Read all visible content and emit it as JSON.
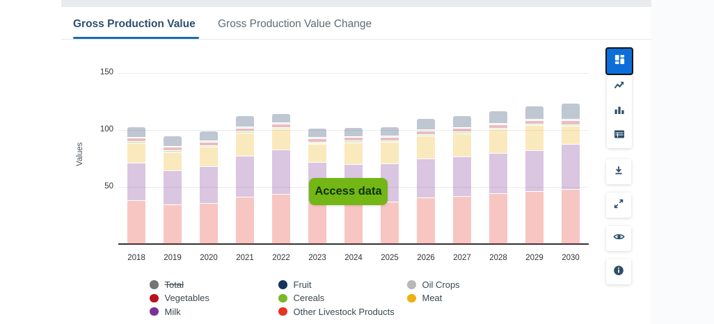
{
  "tabs": [
    {
      "label": "Gross Production Value",
      "active": true
    },
    {
      "label": "Gross Production Value Change",
      "active": false
    }
  ],
  "access_button": {
    "label": "Access data"
  },
  "colors": {
    "accent_blue_underline": "#1b6cb3",
    "active_view_button": "#0b6fd9",
    "access_button_green": "#73b616",
    "axis_line": "#303030",
    "gridline": "#ececec",
    "toolbar_icon": "#2e4d68"
  },
  "chart_data": {
    "type": "bar",
    "stacked": true,
    "title": "",
    "xlabel": "",
    "ylabel": "Values",
    "yticks": [
      50,
      100,
      150
    ],
    "ylim": [
      0,
      160
    ],
    "grid": true,
    "bar_fill_opacity": 0.28,
    "categories": [
      "2018",
      "2019",
      "2020",
      "2021",
      "2022",
      "2023",
      "2024",
      "2025",
      "2026",
      "2027",
      "2028",
      "2029",
      "2030"
    ],
    "series": [
      {
        "name": "Other Livestock Products",
        "color": "#e63323",
        "values": [
          38,
          34,
          35.5,
          41,
          43.5,
          36.5,
          35,
          36.5,
          40,
          41.5,
          44,
          45.5,
          47.5
        ]
      },
      {
        "name": "Milk",
        "color": "#7b3294",
        "values": [
          33,
          30,
          32,
          36,
          39,
          35,
          34.5,
          33.5,
          34.5,
          35,
          35,
          36,
          39.5
        ]
      },
      {
        "name": "Meat",
        "color": "#eeb111",
        "values": [
          17,
          16,
          17,
          20,
          18,
          16,
          19,
          19,
          20,
          20,
          21,
          22,
          16
        ]
      },
      {
        "name": "Cereals",
        "color": "#7ab828",
        "values": [
          1.5,
          1.5,
          1.5,
          1.5,
          1.5,
          1.5,
          1.5,
          1.5,
          1.5,
          1.5,
          1.5,
          1.5,
          1.5
        ]
      },
      {
        "name": "Vegetables",
        "color": "#b5121b",
        "values": [
          3,
          3,
          3,
          3,
          3,
          3,
          3,
          3,
          3,
          3,
          3,
          3,
          3.5
        ]
      },
      {
        "name": "Oil Crops",
        "color": "#b8b8b8",
        "values": [
          1,
          1,
          1,
          1,
          1,
          1,
          1,
          1,
          1,
          1,
          1,
          1,
          1
        ]
      },
      {
        "name": "Fruit",
        "color": "#16355c",
        "values": [
          9,
          9,
          9,
          9.5,
          8,
          8,
          8,
          8,
          10,
          10.5,
          11,
          11.5,
          14
        ]
      }
    ]
  },
  "legend": {
    "columns": [
      {
        "items": [
          {
            "label": "Total",
            "color": "#757575",
            "disabled": true
          },
          {
            "label": "Vegetables",
            "color": "#b5121b",
            "disabled": false
          },
          {
            "label": "Milk",
            "color": "#7b3294",
            "disabled": false
          }
        ]
      },
      {
        "items": [
          {
            "label": "Fruit",
            "color": "#16355c",
            "disabled": false
          },
          {
            "label": "Cereals",
            "color": "#7ab828",
            "disabled": false
          },
          {
            "label": "Other Livestock Products",
            "color": "#e63323",
            "disabled": false
          }
        ]
      },
      {
        "items": [
          {
            "label": "Oil Crops",
            "color": "#b8b8b8",
            "disabled": false
          },
          {
            "label": "Meat",
            "color": "#eeb111",
            "disabled": false
          }
        ]
      }
    ]
  },
  "toolbar": {
    "view_buttons": [
      {
        "icon": "dashboard-icon",
        "active": true
      },
      {
        "icon": "line-chart-icon",
        "active": false
      },
      {
        "icon": "bar-chart-icon",
        "active": false
      },
      {
        "icon": "table-icon",
        "active": false
      }
    ],
    "action_buttons": [
      {
        "icon": "download-icon"
      },
      {
        "icon": "expand-icon"
      },
      {
        "icon": "eye-icon"
      },
      {
        "icon": "info-icon"
      }
    ]
  }
}
